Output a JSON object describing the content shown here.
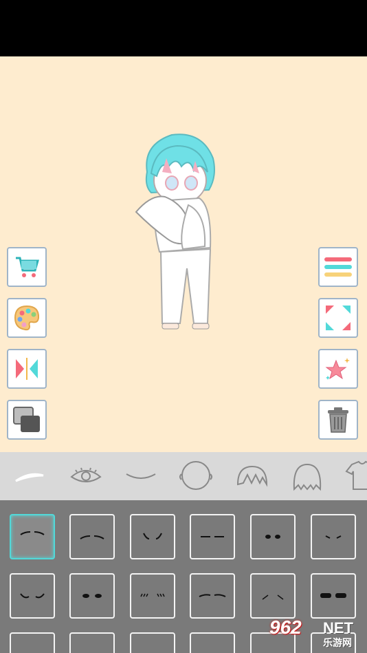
{
  "colors": {
    "stage_background": "#feeccf",
    "tab_bar_background": "#d9d9d9",
    "grid_background": "#7a7a7a",
    "selected_accent": "#52d9d9",
    "button_border": "#9fb4c8"
  },
  "left_toolbar": [
    {
      "name": "shop-cart-button",
      "icon": "cart-icon"
    },
    {
      "name": "color-palette-button",
      "icon": "palette-icon"
    },
    {
      "name": "flip-button",
      "icon": "mirror-flip-icon"
    },
    {
      "name": "layers-button",
      "icon": "layers-icon"
    }
  ],
  "right_toolbar": [
    {
      "name": "menu-button",
      "icon": "menu-icon"
    },
    {
      "name": "fullscreen-button",
      "icon": "expand-icon"
    },
    {
      "name": "favorite-button",
      "icon": "star-sparkle-icon"
    },
    {
      "name": "delete-button",
      "icon": "trash-icon"
    }
  ],
  "category_tabs": [
    "eyebrows",
    "eyes",
    "mouth",
    "face",
    "bangs",
    "back-hair",
    "outfit"
  ],
  "selected_tab": "eyebrows",
  "eyebrow_options_selected_index": 0,
  "watermark": {
    "number": "962",
    "net": "NET",
    "chinese": "乐游网"
  }
}
